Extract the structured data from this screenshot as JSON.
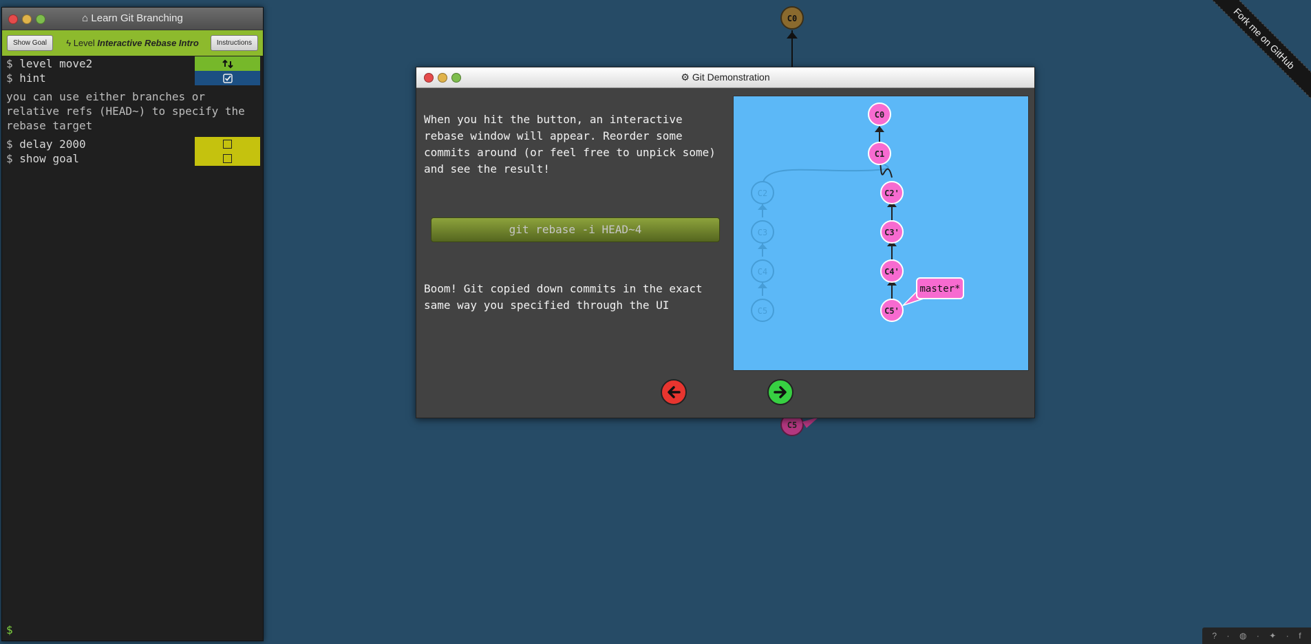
{
  "background": {
    "top_commit": "C0",
    "bottom_commit": "C5"
  },
  "ribbon": {
    "text": "Fork me on GitHub"
  },
  "terminal": {
    "title": "Learn Git Branching",
    "show_goal_label": "Show Goal",
    "level_prefix": "Level",
    "level_name": "Interactive Rebase Intro",
    "instructions_label": "Instructions",
    "commands": [
      {
        "text": "level move2",
        "status_icon": "retry-icon"
      },
      {
        "text": "hint",
        "status_icon": "checked-box-icon"
      }
    ],
    "hint_text": "you can use either branches or relative refs (HEAD~) to specify the rebase target",
    "commands2": [
      {
        "text": "delay 2000",
        "status_icon": "unchecked-box-icon"
      },
      {
        "text": "show goal",
        "status_icon": "unchecked-box-icon"
      }
    ],
    "prompt": "$",
    "dollar": "$"
  },
  "demo": {
    "title": "Git Demonstration",
    "intro": "When you hit the button, an interactive rebase window will appear. Reorder some commits around (or feel free to unpick some) and see the result!",
    "command_button": "git rebase -i HEAD~4",
    "result": "Boom! Git copied down commits in the exact same way you specified through the UI",
    "graph": {
      "main_commits": [
        "C0",
        "C1",
        "C2'",
        "C3'",
        "C4'",
        "C5'"
      ],
      "ghost_commits": [
        "C2",
        "C3",
        "C4",
        "C5"
      ],
      "branch_label": "master*"
    },
    "prev_icon": "arrow-left-icon",
    "next_icon": "arrow-right-icon"
  },
  "footer": {
    "icons": [
      "help-icon",
      "globe-icon",
      "twitter-icon",
      "facebook-icon"
    ],
    "separator": "·",
    "facebook_glyph": "f"
  },
  "colors": {
    "background": "#264b66",
    "level_bar": "#8dba2d",
    "commit_pink": "#f76bd0",
    "viz_blue": "#5cb8f7"
  }
}
